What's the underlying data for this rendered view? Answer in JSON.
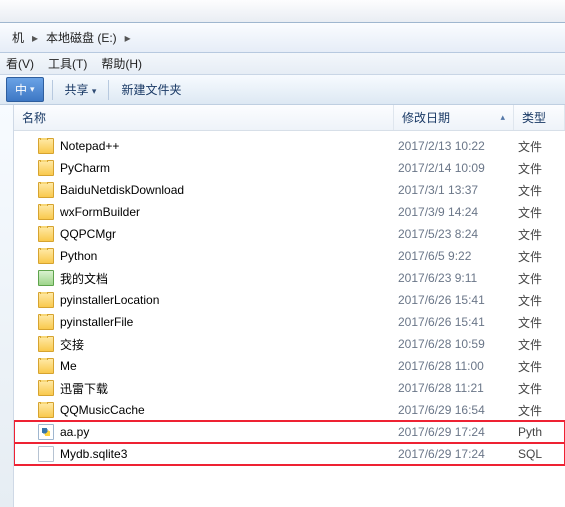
{
  "breadcrumb": {
    "seg1": "机",
    "arrow1": "▸",
    "seg2": "本地磁盘 (E:)",
    "arrow2": "▸"
  },
  "menus": {
    "view": "看(V)",
    "tools": "工具(T)",
    "help": "帮助(H)"
  },
  "toolbar": {
    "include": "中",
    "share": "共享",
    "newfolder": "新建文件夹",
    "drop": "▾"
  },
  "columns": {
    "name": "名称",
    "date": "修改日期",
    "type": "类型",
    "sort_arrow": "▴"
  },
  "rows": [
    {
      "icon": "folder",
      "name": "Notepad++",
      "date": "2017/2/13 10:22",
      "type": "文件",
      "hl": false
    },
    {
      "icon": "folder",
      "name": "PyCharm",
      "date": "2017/2/14 10:09",
      "type": "文件",
      "hl": false
    },
    {
      "icon": "folder",
      "name": "BaiduNetdiskDownload",
      "date": "2017/3/1 13:37",
      "type": "文件",
      "hl": false
    },
    {
      "icon": "folder",
      "name": "wxFormBuilder",
      "date": "2017/3/9 14:24",
      "type": "文件",
      "hl": false
    },
    {
      "icon": "folder",
      "name": "QQPCMgr",
      "date": "2017/5/23 8:24",
      "type": "文件",
      "hl": false
    },
    {
      "icon": "folder",
      "name": "Python",
      "date": "2017/6/5 9:22",
      "type": "文件",
      "hl": false
    },
    {
      "icon": "docfolder",
      "name": "我的文档",
      "date": "2017/6/23 9:11",
      "type": "文件",
      "hl": false
    },
    {
      "icon": "folder",
      "name": "pyinstallerLocation",
      "date": "2017/6/26 15:41",
      "type": "文件",
      "hl": false
    },
    {
      "icon": "folder",
      "name": "pyinstallerFile",
      "date": "2017/6/26 15:41",
      "type": "文件",
      "hl": false
    },
    {
      "icon": "folder",
      "name": "交接",
      "date": "2017/6/28 10:59",
      "type": "文件",
      "hl": false
    },
    {
      "icon": "folder",
      "name": "Me",
      "date": "2017/6/28 11:00",
      "type": "文件",
      "hl": false
    },
    {
      "icon": "folder",
      "name": "迅雷下载",
      "date": "2017/6/28 11:21",
      "type": "文件",
      "hl": false
    },
    {
      "icon": "folder",
      "name": "QQMusicCache",
      "date": "2017/6/29 16:54",
      "type": "文件",
      "hl": false
    },
    {
      "icon": "pyfile",
      "name": "aa.py",
      "date": "2017/6/29 17:24",
      "type": "Pyth",
      "hl": true
    },
    {
      "icon": "blankfile",
      "name": "Mydb.sqlite3",
      "date": "2017/6/29 17:24",
      "type": "SQL",
      "hl": true
    }
  ]
}
